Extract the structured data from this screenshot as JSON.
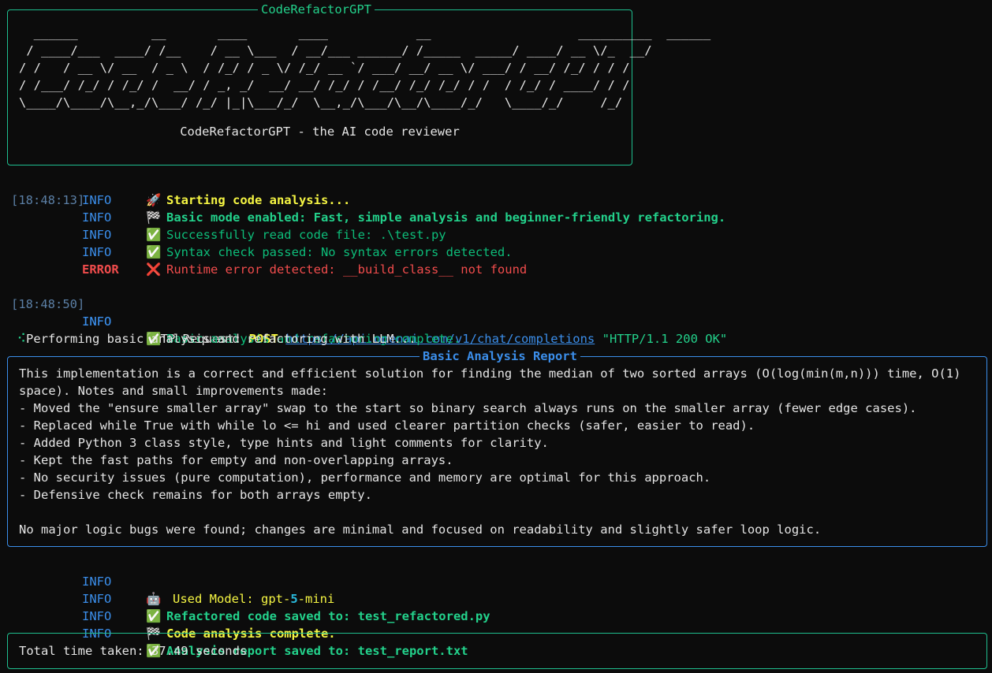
{
  "header": {
    "panel_title": "CodeRefactorGPT",
    "ascii_art": "  ______          __       ____       ____            __                    __________  ______\n / ____/___  ____/ /__    / __ \\___  / __/___ ______/ /_____  _____/ ____/ __ \\/_  __/\n/ /   / __ \\/ __  / _ \\  / /_/ / _ \\/ /_/ __ `/ ___/ __/ __ \\/ ___/ / __/ /_/ / / /\n/ /___/ /_/ / /_/ /  __/ / _, _/  __/ __/ /_/ / /__/ /_/ /_/ / /  / /_/ / ____/ / /\n\\____/\\____/\\__,_/\\___/ /_/ |_|\\___/_/  \\__,_/\\___/\\__/\\____/_/   \\____/_/     /_/",
    "subtitle": "CodeRefactorGPT - the AI code reviewer"
  },
  "logs1": [
    {
      "ts": "[18:48:13]",
      "level": "INFO",
      "icon": "🚀",
      "icon_name": "rocket-icon",
      "text": "Starting code analysis...",
      "style": "y b"
    },
    {
      "ts": "",
      "level": "INFO",
      "icon": "🏁",
      "icon_name": "checkered-flag-icon",
      "text": "Basic mode enabled: Fast, simple analysis and beginner-friendly refactoring.",
      "style": "g b"
    },
    {
      "ts": "",
      "level": "INFO",
      "icon": "✅",
      "icon_name": "check-icon",
      "text": "Successfully read code file: .\\test.py",
      "style": "gd"
    },
    {
      "ts": "",
      "level": "INFO",
      "icon": "✅",
      "icon_name": "check-icon",
      "text": "Syntax check passed: No syntax errors detected.",
      "style": "gd"
    },
    {
      "ts": "",
      "level": "ERROR",
      "icon": "❌",
      "icon_name": "cross-icon",
      "text": "Runtime error detected: __build_class__ not found",
      "style": "r"
    }
  ],
  "http": {
    "ts": "[18:48:50]",
    "level": "INFO",
    "prefix": "HTTP Request: ",
    "method": "POST",
    "url": "https://api.openai.com/v1/chat/completions",
    "status": "\"HTTP/1.1 200 OK\""
  },
  "log_complete": {
    "level": "INFO",
    "icon": "✅",
    "text": "Basic analysis and refactoring complete."
  },
  "spinner": {
    "glyph": "⠪",
    "text": "Performing basic analysis and refactoring with LLM..."
  },
  "report": {
    "title": "Basic Analysis Report",
    "lines": [
      "This implementation is a correct and efficient solution for finding the median of two sorted arrays (O(log(min(m,n))) time, O(1)",
      "space). Notes and small improvements made:",
      "- Moved the \"ensure smaller array\" swap to the start so binary search always runs on the smaller array (fewer edge cases).",
      "- Replaced while True with while lo <= hi and used clearer partition checks (safer, easier to read).",
      "- Added Python 3 class style, type hints and light comments for clarity.",
      "- Kept the fast paths for empty and non-overlapping arrays.",
      "- No security issues (pure computation), performance and memory are optimal for this approach.",
      "- Defensive check remains for both arrays empty.",
      "",
      "No major logic bugs were found; changes are minimal and focused on readability and slightly safer loop logic."
    ]
  },
  "logs2": {
    "model": {
      "level": "INFO",
      "icon": "🤖",
      "label": "Used Model: ",
      "name_a": "gpt-",
      "name_b": "5",
      "name_c": "-mini"
    },
    "saved_code": {
      "level": "INFO",
      "icon": "✅",
      "text": "Refactored code saved to: test_refactored.py"
    },
    "done": {
      "level": "INFO",
      "icon": "🏁",
      "text": "Code analysis complete."
    },
    "saved_report": {
      "level": "INFO",
      "icon": "✅",
      "text": "Analysis report saved to: test_report.txt"
    }
  },
  "footer": {
    "text": "Total time taken: 37.49 seconds"
  },
  "colors": {
    "panel_border": "#1fbf8f",
    "report_border": "#3b8eea",
    "background": "#0c0c0c"
  }
}
